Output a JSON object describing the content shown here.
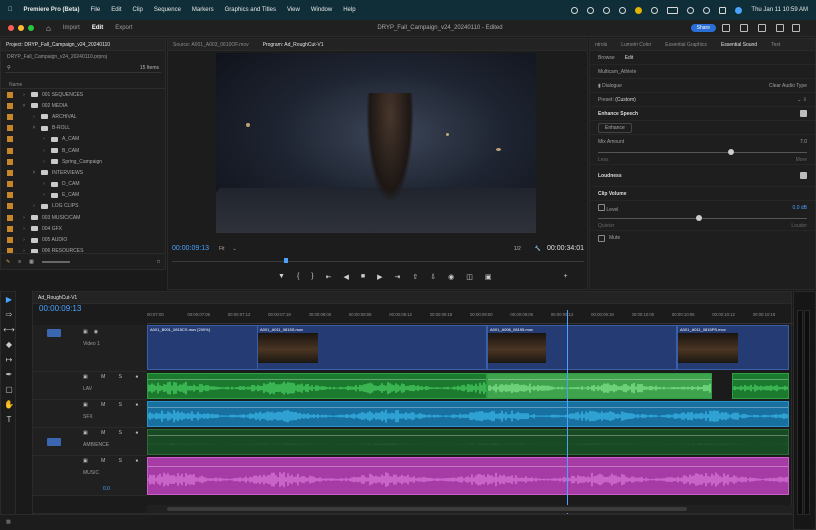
{
  "menubar": {
    "app_name": "Premiere Pro (Beta)",
    "menus": [
      "File",
      "Edit",
      "Clip",
      "Sequence",
      "Markers",
      "Graphics and Titles",
      "View",
      "Window",
      "Help"
    ],
    "clock": "Thu Jan 11  10:59 AM"
  },
  "header": {
    "workspaces": [
      "Import",
      "Edit",
      "Export"
    ],
    "active_workspace": "Edit",
    "doc_title": "DRYP_Fall_Campaign_v24_20240110 - Edited",
    "share_label": "Share"
  },
  "project": {
    "tab_project": "Project: DRYP_Fall_Campaign_v24_20240110",
    "tab_source": "Source: A001_A003_0610OF.mov",
    "file": "DRYP_Fall_Campaign_v24_20240110.prproj",
    "item_count": "15 Items",
    "name_header": "Name",
    "tree": [
      {
        "label": "001 SEQUENCES",
        "depth": 0,
        "open": false
      },
      {
        "label": "002 MEDIA",
        "depth": 0,
        "open": true
      },
      {
        "label": "ARCHIVAL",
        "depth": 1,
        "open": false
      },
      {
        "label": "B-ROLL",
        "depth": 1,
        "open": true
      },
      {
        "label": "A_CAM",
        "depth": 2,
        "open": false
      },
      {
        "label": "B_CAM",
        "depth": 2,
        "open": false
      },
      {
        "label": "Spring_Campaign",
        "depth": 2,
        "open": false
      },
      {
        "label": "INTERVIEWS",
        "depth": 1,
        "open": true
      },
      {
        "label": "D_CAM",
        "depth": 2,
        "open": false
      },
      {
        "label": "E_CAM",
        "depth": 2,
        "open": false
      },
      {
        "label": "LOG CLIPS",
        "depth": 1,
        "open": false
      },
      {
        "label": "003 MUSIC/CAM",
        "depth": 0,
        "open": false
      },
      {
        "label": "004 GFX",
        "depth": 0,
        "open": false
      },
      {
        "label": "005 AUDIO",
        "depth": 0,
        "open": false
      },
      {
        "label": "006 RESOURCES",
        "depth": 0,
        "open": false
      }
    ]
  },
  "program": {
    "tab_label": "Program: Ad_RoughCut-V1",
    "timecode_in": "00:00:09:13",
    "fit": "Fit",
    "quality": "1/2",
    "timecode_out": "00:00:34:01"
  },
  "essential": {
    "tabs": [
      "ntrols",
      "Lumetri Color",
      "Essential Graphics",
      "Essential Sound",
      "Text"
    ],
    "active_tab": "Essential Sound",
    "subtabs": [
      "Browse",
      "Edit"
    ],
    "clip_name": "Multicam_Athlete",
    "type": "Dialogue",
    "clear_label": "Clear Audio Type",
    "preset_label": "Preset:",
    "preset_value": "(Custom)",
    "enhance_speech": "Enhance Speech",
    "enhance_btn": "Enhance",
    "mix_amount": "Mix Amount",
    "mix_value": "7.0",
    "less": "Less",
    "more": "More",
    "loudness": "Loudness",
    "clip_volume": "Clip Volume",
    "level": "Level",
    "level_value": "0.0 dB",
    "quieter": "Quieter",
    "louder": "Louder",
    "mute": "Mute"
  },
  "timeline": {
    "sequence_tab": "Ad_RoughCut-V1",
    "timecode": "00:00:09:13",
    "ruler": [
      "00:07:00",
      "00:00:07:06",
      "00:00:07:12",
      "00:00:07:18",
      "00:00:08:00",
      "00:00:08:06",
      "00:00:08:12",
      "00:00:08:18",
      "00:00:09:00",
      "00:00:09:06",
      "00:00:09:12",
      "00:00:09:18",
      "00:00:10:00",
      "00:00:10:06",
      "00:00:10:12",
      "00:00:10:18"
    ],
    "tracks": [
      {
        "name": "Video 1",
        "kind": "video"
      },
      {
        "name": "LAV",
        "kind": "audio"
      },
      {
        "name": "SFX",
        "kind": "audio"
      },
      {
        "name": "AMBIENCE",
        "kind": "audio"
      },
      {
        "name": "MUSIC",
        "kind": "audio"
      }
    ],
    "video_clips": [
      "A001_B001_0815CS.mov [200%]",
      "A001_A011_0815S.mov",
      "A001_A006_08195.mov",
      "A001_A011_0815PS.mov"
    ],
    "master_level": "0.0"
  },
  "colors": {
    "accent": "#4aa3ff",
    "video_clip": "#243c73",
    "audio_green": "#1b7a2e",
    "audio_cyan": "#1770a0",
    "audio_pink": "#a63ba6",
    "folder": "#c8862a"
  }
}
